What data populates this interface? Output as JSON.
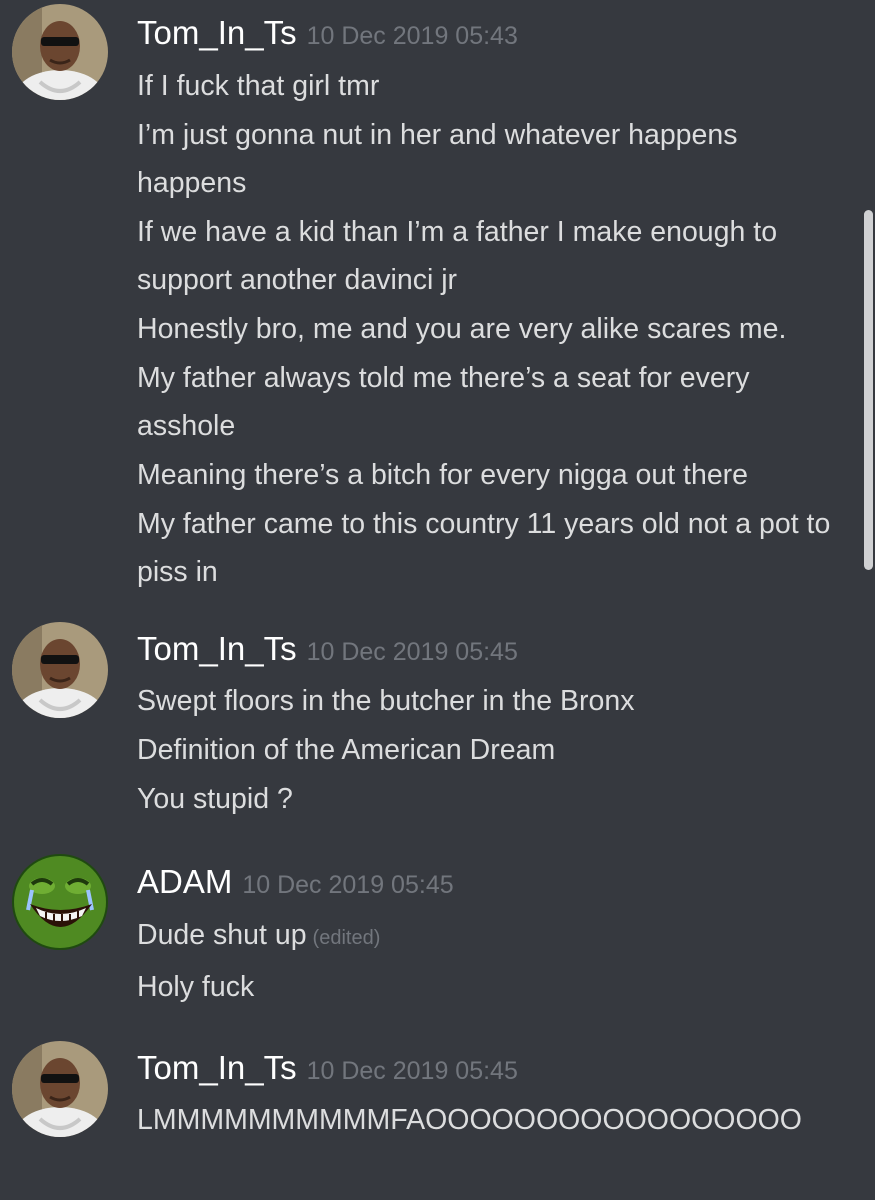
{
  "messages": [
    {
      "username": "Tom_In_Ts",
      "timestamp": "10 Dec 2019 05:43",
      "avatar_icon": "user-avatar-sunglasses",
      "lines": [
        "If I fuck that girl tmr",
        "I’m just gonna nut in her and whatever happens happens",
        "If we have a kid than I’m a father I make enough to support another davinci jr",
        "Honestly bro, me and you are very alike scares me.",
        "My father always told me there’s a seat for every asshole",
        "Meaning there’s a bitch for every nigga out there",
        "My father came to this country 11 years old not a pot to piss in"
      ]
    },
    {
      "username": "Tom_In_Ts",
      "timestamp": "10 Dec 2019 05:45",
      "avatar_icon": "user-avatar-sunglasses",
      "lines": [
        "Swept floors in the butcher in the Bronx",
        "Definition of the American Dream",
        "You stupid ?"
      ]
    },
    {
      "username": "ADAM",
      "timestamp": "10 Dec 2019 05:45",
      "avatar_icon": "pepe-laughing-avatar",
      "lines": [
        "Dude shut up",
        "Holy fuck"
      ],
      "edited_label": "(edited)"
    },
    {
      "username": "Tom_In_Ts",
      "timestamp": "10 Dec 2019 05:45",
      "avatar_icon": "user-avatar-sunglasses",
      "lines": [
        "LMMMMMMMMMMFAOOOOOOOOOOOOOOOOO"
      ]
    }
  ],
  "colors": {
    "background": "#36393f",
    "username": "#ffffff",
    "message_text": "#dcddde",
    "timestamp": "#72767d",
    "scrollbar": "#d0d1d3"
  }
}
